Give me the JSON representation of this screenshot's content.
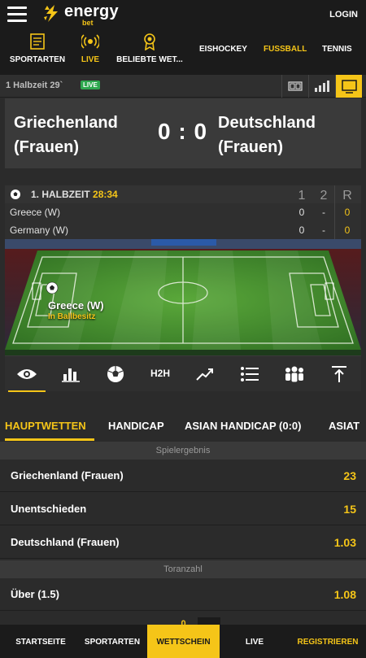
{
  "header": {
    "brand": "energy",
    "brand_sub": "bet",
    "login": "LOGIN"
  },
  "nav": {
    "items": [
      {
        "label": "SPORTARTEN",
        "icon": "sports-list-icon"
      },
      {
        "label": "LIVE",
        "icon": "live-broadcast-icon"
      },
      {
        "label": "BELIEBTE WET...",
        "icon": "award-medal-icon"
      }
    ],
    "sports": [
      "EISHOCKEY",
      "FUSSBALL",
      "TENNIS"
    ],
    "active_sport": "FUSSBALL"
  },
  "match_bar": {
    "period": "1 Halbzeit 29`",
    "live": "LIVE"
  },
  "scoreboard": {
    "home": "Griechenland (Frauen)",
    "away": "Deutschland (Frauen)",
    "score": "0 : 0"
  },
  "stats": {
    "half": "1. HALBZEIT",
    "time": "28:34",
    "cols": [
      "1",
      "2",
      "R"
    ],
    "rows": [
      {
        "team": "Greece (W)",
        "h1": "0",
        "h2": "-",
        "r": "0"
      },
      {
        "team": "Germany (W)",
        "h1": "0",
        "h2": "-",
        "r": "0"
      }
    ]
  },
  "pitch": {
    "team": "Greece (W)",
    "status": "In Ballbesitz"
  },
  "tools": {
    "h2h": "H2H"
  },
  "market_tabs": [
    "HAUPTWETTEN",
    "HANDICAP",
    "ASIAN HANDICAP (0:0)",
    "ASIAT"
  ],
  "markets": [
    {
      "title": "Spielergebnis",
      "rows": [
        {
          "name": "Griechenland (Frauen)",
          "odd": "23"
        },
        {
          "name": "Unentschieden",
          "odd": "15"
        },
        {
          "name": "Deutschland (Frauen)",
          "odd": "1.03"
        }
      ]
    },
    {
      "title": "Toranzahl",
      "rows": [
        {
          "name": "Über (1.5)",
          "odd": "1.08"
        }
      ]
    }
  ],
  "bottom_nav": {
    "startseite": "STARTSEITE",
    "sportarten": "SPORTARTEN",
    "wettschein": "WETTSCHEIN",
    "slip_count": "0",
    "live": "LIVE",
    "registrieren": "REGISTRIEREN"
  },
  "colors": {
    "accent": "#f5c518",
    "live_green": "#2ea84f",
    "background": "#2b2b2b"
  }
}
